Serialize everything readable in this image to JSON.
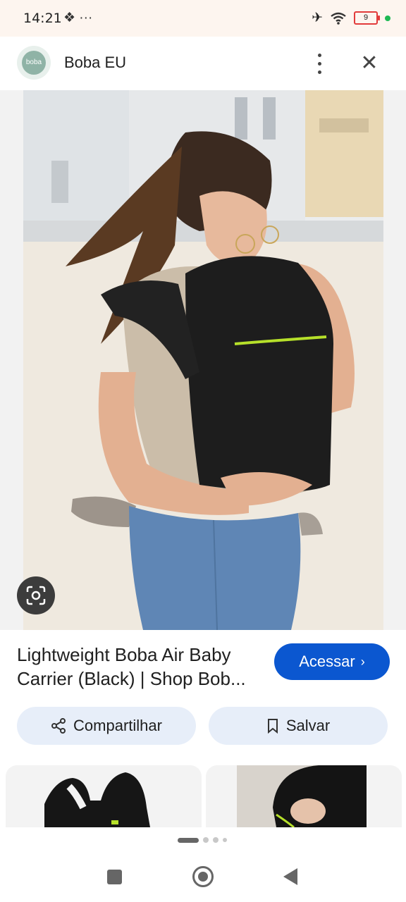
{
  "status_bar": {
    "time": "14:21",
    "battery": "9"
  },
  "header": {
    "site_name": "Boba EU",
    "logo_text": "boba"
  },
  "result": {
    "title_line1": "Lightweight Boba Air Baby",
    "title_line2": "Carrier (Black) | Shop Bob...",
    "visit_label": "Acessar",
    "share_label": "Compartilhar",
    "save_label": "Salvar"
  },
  "colors": {
    "accent": "#0b57d0",
    "pill": "#e7eef9",
    "lime_zip": "#b6e02a"
  },
  "icons": [
    "airplane-icon",
    "wifi-icon",
    "battery-icon",
    "more-vert-icon",
    "close-icon",
    "lens-icon",
    "share-icon",
    "bookmark-icon",
    "chevron-right-icon"
  ]
}
